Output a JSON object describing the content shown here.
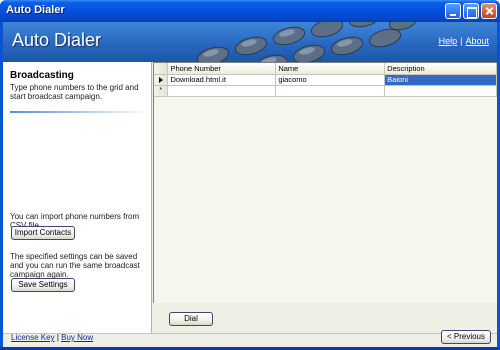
{
  "window": {
    "title": "Auto Dialer"
  },
  "header": {
    "app_title": "Auto Dialer",
    "help_link": "Help",
    "separator": "|",
    "about_link": "About"
  },
  "left_panel": {
    "title": "Broadcasting",
    "description": "Type phone numbers to the grid and start broadcast campaign.",
    "import_text": "You can import phone numbers from CSV file.",
    "import_button": "Import Contacts",
    "save_text": "The specified settings can be saved and you can run the same broadcast campaign again.",
    "save_button": "Save Settings"
  },
  "grid": {
    "columns": [
      "Phone Number",
      "Name",
      "Description"
    ],
    "rows": [
      {
        "phone": "Download.html.it",
        "name": "giacomo",
        "description": "Baioni"
      }
    ],
    "new_row_marker": "*"
  },
  "dial_button": "Dial",
  "footer": {
    "license_link": "License Key",
    "separator": "|",
    "buy_link": "Buy Now",
    "previous_button": "< Previous"
  },
  "colors": {
    "titlebar": "#0550dc",
    "header": "#2968c0",
    "selection": "#316ac5"
  }
}
